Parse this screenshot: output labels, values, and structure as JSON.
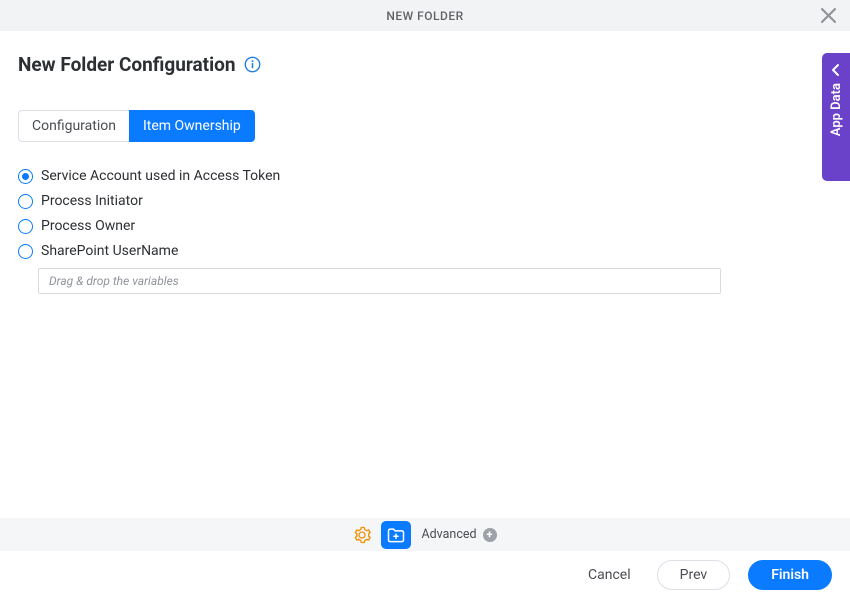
{
  "header": {
    "title": "NEW FOLDER"
  },
  "page": {
    "title": "New Folder Configuration"
  },
  "tabs": [
    {
      "id": "configuration",
      "label": "Configuration",
      "active": false
    },
    {
      "id": "item-ownership",
      "label": "Item Ownership",
      "active": true
    }
  ],
  "ownership_options": [
    {
      "id": "service-account",
      "label": "Service Account used in Access Token",
      "selected": true
    },
    {
      "id": "process-initiator",
      "label": "Process Initiator",
      "selected": false
    },
    {
      "id": "process-owner",
      "label": "Process Owner",
      "selected": false
    },
    {
      "id": "sharepoint-username",
      "label": "SharePoint UserName",
      "selected": false
    }
  ],
  "variable_input": {
    "placeholder": "Drag & drop the variables",
    "value": ""
  },
  "side_panel": {
    "label": "App Data"
  },
  "toolbar": {
    "advanced_label": "Advanced"
  },
  "footer": {
    "cancel_label": "Cancel",
    "prev_label": "Prev",
    "finish_label": "Finish"
  },
  "colors": {
    "accent_blue": "#0a7bff",
    "accent_purple": "#6a41c9",
    "gear_orange": "#f0920a"
  }
}
